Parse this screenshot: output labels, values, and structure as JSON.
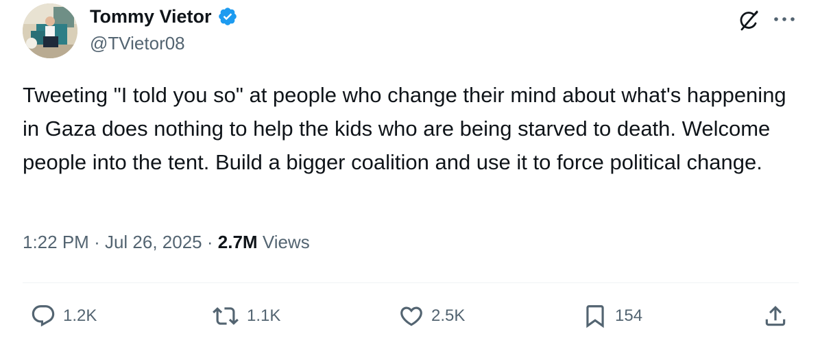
{
  "author": {
    "display_name": "Tommy Vietor",
    "handle": "@TVietor08",
    "verified": true
  },
  "tweet": {
    "text": "Tweeting \"I told you so\" at people who change their mind about what's happening in Gaza does nothing to help the kids who are being starved to death. Welcome people into the tent. Build a bigger coalition and use it to force political change.",
    "time": "1:22 PM",
    "separator": "·",
    "date": "Jul 26, 2025",
    "views_count": "2.7M",
    "views_label": "Views"
  },
  "actions": {
    "replies": "1.2K",
    "reposts": "1.1K",
    "likes": "2.5K",
    "bookmarks": "154"
  },
  "icons": {
    "verified": "verified-badge-icon",
    "grok": "grok-icon",
    "more": "more-icon",
    "reply": "reply-icon",
    "repost": "repost-icon",
    "like": "heart-icon",
    "bookmark": "bookmark-icon",
    "share": "share-icon"
  },
  "colors": {
    "text_primary": "#0f1419",
    "text_secondary": "#536471",
    "verified_blue": "#1d9bf0",
    "divider": "#eff3f4"
  }
}
